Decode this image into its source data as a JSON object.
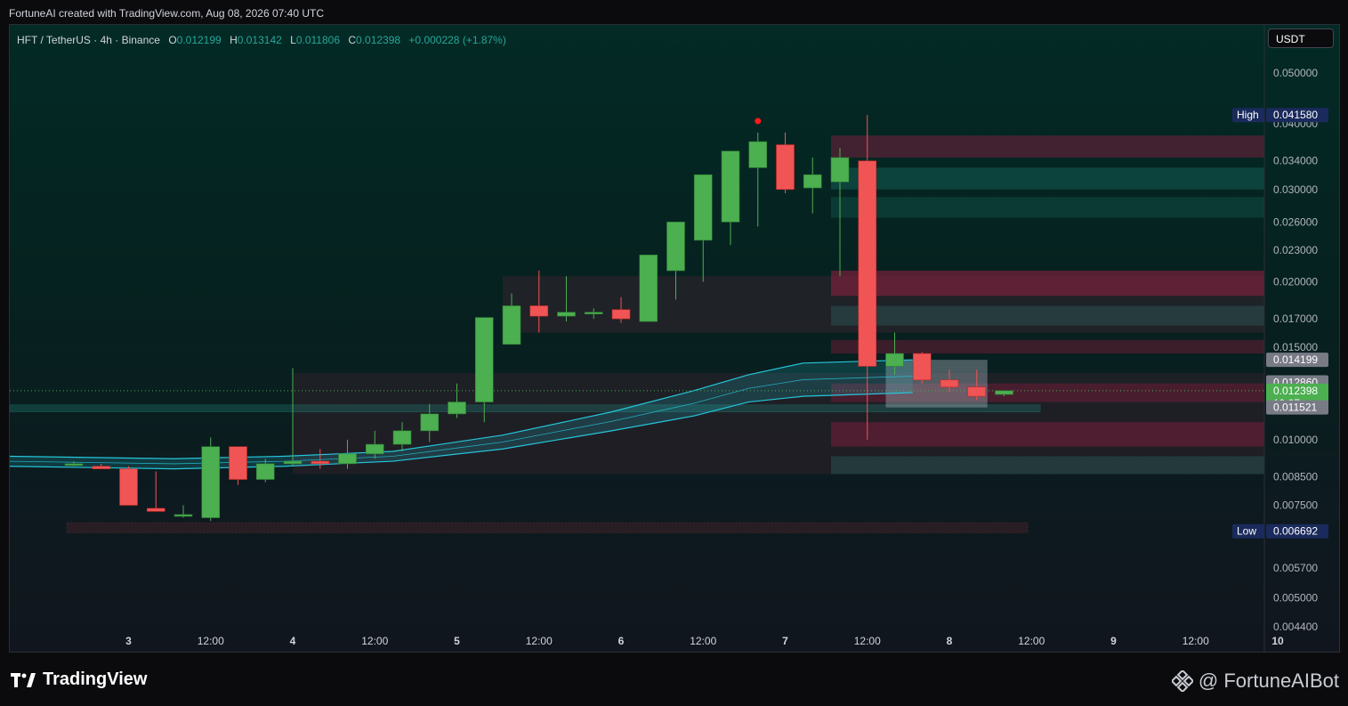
{
  "header": {
    "credit": "FortuneAI created with TradingView.com, Aug 08, 2026 07:40 UTC"
  },
  "legend": {
    "symbol": "HFT / TetherUS · 4h · Binance",
    "o_label": "O",
    "o": "0.012199",
    "h_label": "H",
    "h": "0.013142",
    "l_label": "L",
    "l": "0.011806",
    "c_label": "C",
    "c": "0.012398",
    "change": "+0.000228 (+1.87%)"
  },
  "currency_button": "USDT",
  "colors": {
    "up": "#4caf50",
    "down": "#f05454",
    "band": "#26c6da",
    "legend_value": "#26a69a"
  },
  "chart_data": {
    "type": "candlestick",
    "y_scale": "log",
    "ylim": [
      0.0044,
      0.052
    ],
    "y_ticks": [
      {
        "v": 0.05,
        "label": "0.050000"
      },
      {
        "v": 0.04,
        "label": "0.040000"
      },
      {
        "v": 0.034,
        "label": "0.034000"
      },
      {
        "v": 0.03,
        "label": "0.030000"
      },
      {
        "v": 0.026,
        "label": "0.026000"
      },
      {
        "v": 0.023,
        "label": "0.023000"
      },
      {
        "v": 0.02,
        "label": "0.020000"
      },
      {
        "v": 0.017,
        "label": "0.017000"
      },
      {
        "v": 0.015,
        "label": "0.015000"
      },
      {
        "v": 0.01,
        "label": "0.010000"
      },
      {
        "v": 0.0085,
        "label": "0.008500"
      },
      {
        "v": 0.0075,
        "label": "0.007500"
      },
      {
        "v": 0.0057,
        "label": "0.005700"
      },
      {
        "v": 0.005,
        "label": "0.005000"
      },
      {
        "v": 0.0044,
        "label": "0.004400"
      }
    ],
    "x_ticks": [
      {
        "i": 2,
        "label": "3"
      },
      {
        "i": 5,
        "label": "12:00"
      },
      {
        "i": 8,
        "label": "4"
      },
      {
        "i": 11,
        "label": "12:00"
      },
      {
        "i": 14,
        "label": "5"
      },
      {
        "i": 17,
        "label": "12:00"
      },
      {
        "i": 20,
        "label": "6"
      },
      {
        "i": 23,
        "label": "12:00"
      },
      {
        "i": 26,
        "label": "7"
      },
      {
        "i": 29,
        "label": "12:00"
      },
      {
        "i": 32,
        "label": "8"
      },
      {
        "i": 35,
        "label": "12:00"
      },
      {
        "i": 38,
        "label": "9"
      },
      {
        "i": 41,
        "label": "12:00"
      },
      {
        "i": 44,
        "label": "10"
      }
    ],
    "candles": [
      [
        0.009,
        0.0091,
        0.0089,
        0.009
      ],
      [
        0.0089,
        0.009,
        0.0088,
        0.0088
      ],
      [
        0.0088,
        0.0089,
        0.0075,
        0.0075
      ],
      [
        0.0074,
        0.0087,
        0.0074,
        0.0073
      ],
      [
        0.0072,
        0.0075,
        0.0071,
        0.0072
      ],
      [
        0.0071,
        0.0101,
        0.007,
        0.0097
      ],
      [
        0.0097,
        0.0097,
        0.0082,
        0.0084
      ],
      [
        0.0084,
        0.0092,
        0.0083,
        0.009
      ],
      [
        0.009,
        0.0137,
        0.0089,
        0.0091
      ],
      [
        0.0091,
        0.0096,
        0.0088,
        0.009
      ],
      [
        0.009,
        0.01,
        0.0088,
        0.0094
      ],
      [
        0.0094,
        0.0104,
        0.0092,
        0.0098
      ],
      [
        0.0098,
        0.0108,
        0.0095,
        0.0104
      ],
      [
        0.0104,
        0.0117,
        0.0099,
        0.0112
      ],
      [
        0.0112,
        0.0128,
        0.011,
        0.0118
      ],
      [
        0.0118,
        0.0127,
        0.0108,
        0.0171
      ],
      [
        0.0152,
        0.019,
        0.016,
        0.018
      ],
      [
        0.018,
        0.021,
        0.016,
        0.0172
      ],
      [
        0.0172,
        0.0205,
        0.0168,
        0.0175
      ],
      [
        0.0175,
        0.0178,
        0.017,
        0.0175
      ],
      [
        0.0177,
        0.0187,
        0.0167,
        0.017
      ],
      [
        0.0168,
        0.0195,
        0.0169,
        0.0225
      ],
      [
        0.021,
        0.0245,
        0.0185,
        0.026
      ],
      [
        0.024,
        0.03,
        0.02,
        0.032
      ],
      [
        0.026,
        0.0355,
        0.0235,
        0.0355
      ],
      [
        0.033,
        0.0385,
        0.0255,
        0.037
      ],
      [
        0.0365,
        0.0385,
        0.0295,
        0.03
      ],
      [
        0.0302,
        0.0345,
        0.027,
        0.032
      ],
      [
        0.031,
        0.036,
        0.0205,
        0.0345
      ],
      [
        0.034,
        0.0416,
        0.01,
        0.0138
      ],
      [
        0.0138,
        0.016,
        0.0133,
        0.0146
      ],
      [
        0.0146,
        0.0147,
        0.0128,
        0.013
      ],
      [
        0.013,
        0.0136,
        0.0123,
        0.0126
      ],
      [
        0.0126,
        0.0136,
        0.0119,
        0.0121
      ],
      [
        0.0122,
        0.0124,
        0.0121,
        0.0124
      ]
    ],
    "price_tags": [
      {
        "v": 0.04158,
        "label": "0.041580",
        "side": "High",
        "style": "navy"
      },
      {
        "v": 0.014199,
        "label": "0.014199",
        "style": "gray"
      },
      {
        "v": 0.01286,
        "label": "0.012860",
        "style": "gray"
      },
      {
        "v": 0.012398,
        "label": "0.012398",
        "sub": "19:07",
        "style": "green"
      },
      {
        "v": 0.011521,
        "label": "0.011521",
        "style": "gray"
      },
      {
        "v": 0.006692,
        "label": "0.006692",
        "side": "Low",
        "style": "navy"
      }
    ],
    "band": {
      "lower": [
        [
          0,
          0.0089
        ],
        [
          6,
          0.0088
        ],
        [
          10,
          0.0089
        ],
        [
          14,
          0.0091
        ],
        [
          18,
          0.0096
        ],
        [
          22,
          0.0104
        ],
        [
          25,
          0.0111
        ],
        [
          27,
          0.0118
        ],
        [
          29,
          0.0121
        ],
        [
          33,
          0.0123
        ]
      ],
      "upper": [
        [
          0,
          0.0093
        ],
        [
          6,
          0.0092
        ],
        [
          10,
          0.0093
        ],
        [
          14,
          0.0095
        ],
        [
          18,
          0.0102
        ],
        [
          22,
          0.0113
        ],
        [
          25,
          0.0124
        ],
        [
          27,
          0.0133
        ],
        [
          29,
          0.014
        ],
        [
          33,
          0.0142
        ]
      ]
    }
  },
  "footer": {
    "brand": "TradingView",
    "bot": "@ FortuneAIBot"
  }
}
